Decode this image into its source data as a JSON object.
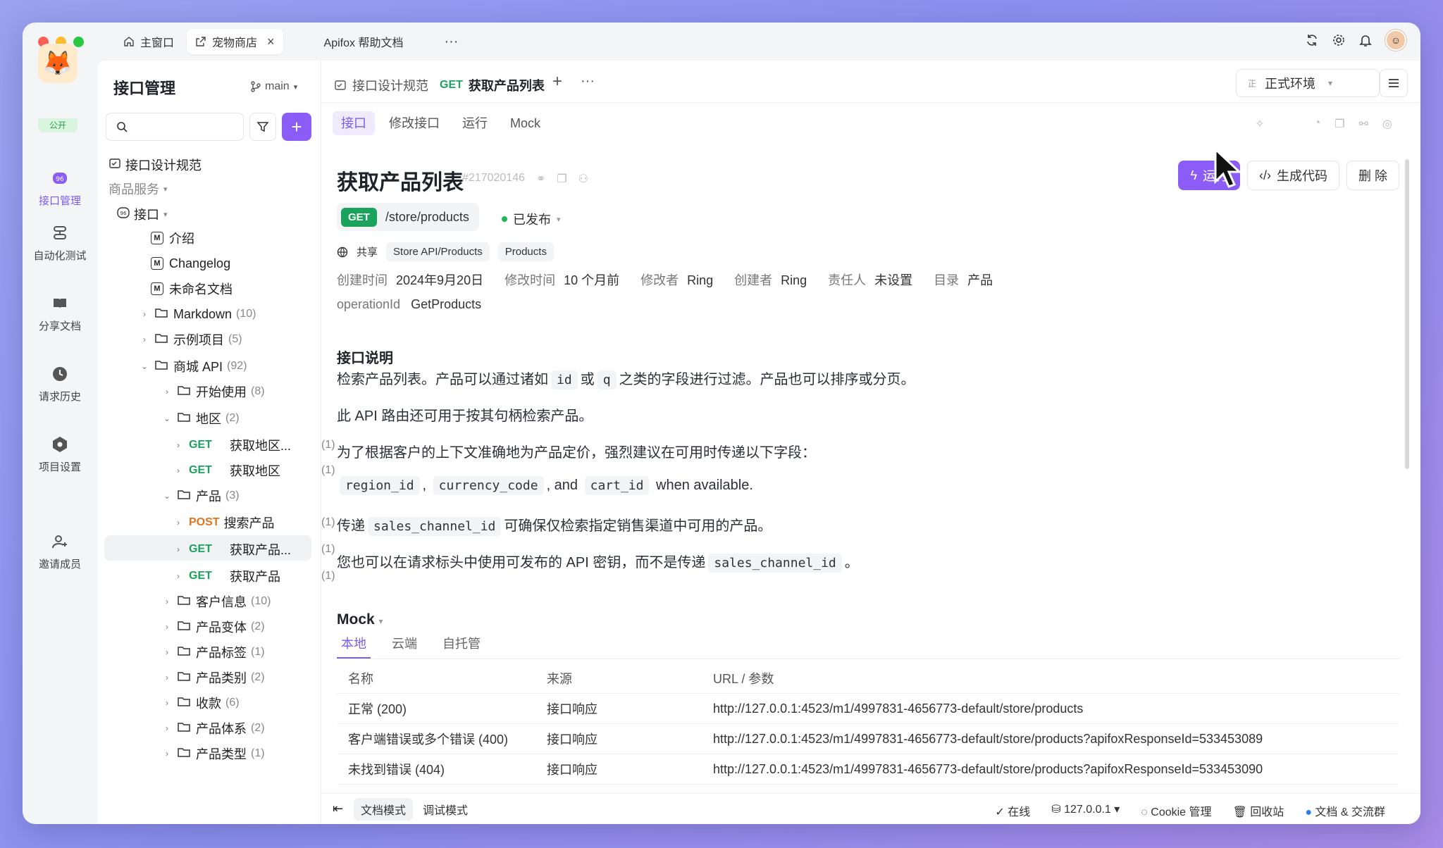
{
  "window_tabs": [
    {
      "label": "主窗口",
      "icon": "home-icon"
    },
    {
      "label": "宠物商店",
      "icon": "share-icon",
      "active": true
    },
    {
      "label": "Apifox 帮助文档"
    }
  ],
  "rail": {
    "public_badge": "公开",
    "items": [
      {
        "label": "接口管理",
        "icon": "api-icon",
        "active": true
      },
      {
        "label": "自动化测试",
        "icon": "automation-icon"
      },
      {
        "label": "分享文档",
        "icon": "book-icon"
      },
      {
        "label": "请求历史",
        "icon": "clock-icon"
      },
      {
        "label": "项目设置",
        "icon": "settings-icon"
      },
      {
        "label": "邀请成员",
        "icon": "invite-user-icon"
      }
    ]
  },
  "sidebar": {
    "title": "接口管理",
    "branch": "main",
    "tree": [
      {
        "label": "接口设计规范",
        "type": "spec",
        "indent": 0
      },
      {
        "label": "商品服务",
        "type": "group",
        "indent": 0
      },
      {
        "label": "接口",
        "type": "root",
        "indent": 1
      },
      {
        "label": "介绍",
        "type": "md",
        "indent": 2
      },
      {
        "label": "Changelog",
        "type": "md",
        "indent": 2
      },
      {
        "label": "未命名文档",
        "type": "md",
        "indent": 2
      },
      {
        "label": "Markdown",
        "count": "(10)",
        "type": "folder",
        "indent": 2,
        "open": false
      },
      {
        "label": "示例项目",
        "count": "(5)",
        "type": "folder",
        "indent": 2,
        "open": false
      },
      {
        "label": "商城 API",
        "count": "(92)",
        "type": "folder",
        "indent": 2,
        "open": true
      },
      {
        "label": "开始使用",
        "count": "(8)",
        "type": "folder",
        "indent": 3,
        "open": false
      },
      {
        "label": "地区",
        "count": "(2)",
        "type": "folder",
        "indent": 3,
        "open": true
      },
      {
        "label": "获取地区...",
        "count": "(1)",
        "type": "api",
        "method": "GET",
        "indent": 4
      },
      {
        "label": "获取地区",
        "count": "(1)",
        "type": "api",
        "method": "GET",
        "indent": 4
      },
      {
        "label": "产品",
        "count": "(3)",
        "type": "folder",
        "indent": 3,
        "open": true
      },
      {
        "label": "搜索产品",
        "count": "(1)",
        "type": "api",
        "method": "POST",
        "indent": 4
      },
      {
        "label": "获取产品...",
        "count": "(1)",
        "type": "api",
        "method": "GET",
        "indent": 4,
        "selected": true
      },
      {
        "label": "获取产品",
        "count": "(1)",
        "type": "api",
        "method": "GET",
        "indent": 4
      },
      {
        "label": "客户信息",
        "count": "(10)",
        "type": "folder",
        "indent": 3,
        "open": false
      },
      {
        "label": "产品变体",
        "count": "(2)",
        "type": "folder",
        "indent": 3,
        "open": false
      },
      {
        "label": "产品标签",
        "count": "(1)",
        "type": "folder",
        "indent": 3,
        "open": false
      },
      {
        "label": "产品类别",
        "count": "(2)",
        "type": "folder",
        "indent": 3,
        "open": false
      },
      {
        "label": "收款",
        "count": "(6)",
        "type": "folder",
        "indent": 3,
        "open": false
      },
      {
        "label": "产品体系",
        "count": "(2)",
        "type": "folder",
        "indent": 3,
        "open": false
      },
      {
        "label": "产品类型",
        "count": "(1)",
        "type": "folder",
        "indent": 3,
        "open": false
      }
    ]
  },
  "tabs": {
    "spec": "接口设计规范",
    "active_method": "GET",
    "active_label": "获取产品列表"
  },
  "env": {
    "badge": "正",
    "label": "正式环境"
  },
  "subtabs": [
    "接口",
    "修改接口",
    "运行",
    "Mock"
  ],
  "api": {
    "title": "获取产品列表",
    "id": "#217020146",
    "method": "GET",
    "path": "/store/products",
    "status": "已发布",
    "shared": "共享",
    "tags": [
      "Store API/Products",
      "Products"
    ],
    "meta": [
      {
        "k": "创建时间",
        "v": "2024年9月20日"
      },
      {
        "k": "修改时间",
        "v": "10 个月前"
      },
      {
        "k": "修改者",
        "v": "Ring"
      },
      {
        "k": "创建者",
        "v": "Ring"
      },
      {
        "k": "责任人",
        "v": "未设置"
      },
      {
        "k": "目录",
        "v": "产品"
      }
    ],
    "operation_key": "operationId",
    "operation_id": "GetProducts"
  },
  "actions": {
    "run": "运行",
    "gen": "生成代码",
    "del": "删 除"
  },
  "desc": {
    "title": "接口说明",
    "p1a": "检索产品列表。产品可以通过诸如",
    "p1c1": "id",
    "p1b": "或",
    "p1c2": "q",
    "p1c": "之类的字段进行过滤。产品也可以排序或分页。",
    "p2": "此 API 路由还可用于按其句柄检索产品。",
    "p3": "为了根据客户的上下文准确地为产品定价，强烈建议在可用时传递以下字段：",
    "p4c1": "region_id",
    "p4a": ",",
    "p4c2": "currency_code",
    "p4b": ", and",
    "p4c3": "cart_id",
    "p4c": "when available.",
    "p5a": "传递",
    "p5c1": "sales_channel_id",
    "p5b": "可确保仅检索指定销售渠道中可用的产品。",
    "p6a": "您也可以在请求标头中使用可发布的 API 密钥，而不是传递",
    "p6c1": "sales_channel_id",
    "p6b": "。"
  },
  "mock": {
    "title": "Mock",
    "tabs": [
      "本地",
      "云端",
      "自托管"
    ],
    "headers": [
      "名称",
      "来源",
      "URL / 参数"
    ],
    "rows": [
      {
        "name": "正常 (200)",
        "source": "接口响应",
        "url": "http://127.0.0.1:4523/m1/4997831-4656773-default/store/products"
      },
      {
        "name": "客户端错误或多个错误 (400)",
        "source": "接口响应",
        "url": "http://127.0.0.1:4523/m1/4997831-4656773-default/store/products?apifoxResponseId=533453089"
      },
      {
        "name": "未找到错误 (404)",
        "source": "接口响应",
        "url": "http://127.0.0.1:4523/m1/4997831-4656773-default/store/products?apifoxResponseId=533453090"
      }
    ]
  },
  "bottom": {
    "doc_mode": "文档模式",
    "debug_mode": "调试模式",
    "online": "在线",
    "host": "127.0.0.1",
    "cookie": "Cookie 管理",
    "trash": "回收站",
    "community": "文档 & 交流群"
  },
  "colors": {
    "accent": "#8b5cf6",
    "get": "#1aa35c",
    "post": "#e0741c"
  }
}
